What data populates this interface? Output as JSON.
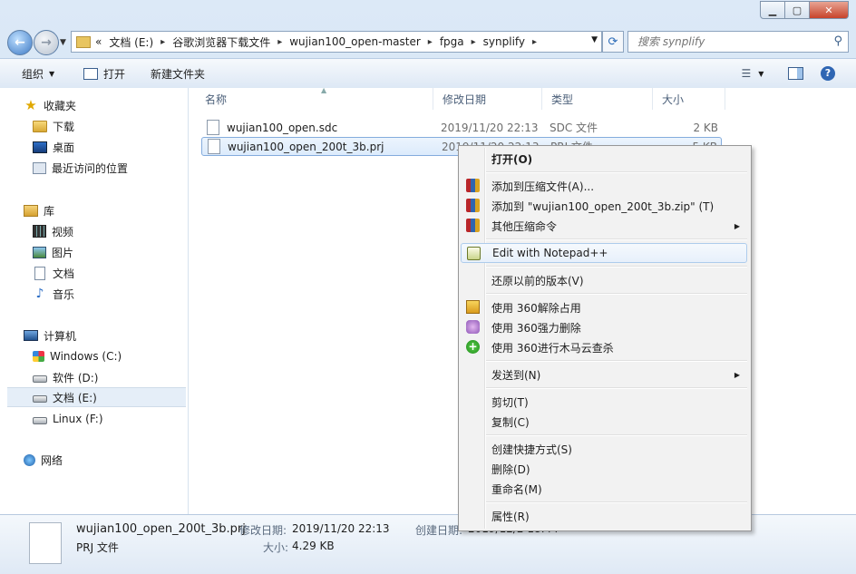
{
  "window": {
    "caption_buttons": [
      "minimize",
      "maximize",
      "close"
    ]
  },
  "address": {
    "overflow": "«",
    "segments": [
      "文档 (E:)",
      "谷歌浏览器下载文件",
      "wujian100_open-master",
      "fpga",
      "synplify"
    ]
  },
  "search": {
    "placeholder": "搜索 synplify"
  },
  "toolbar": {
    "organize": "组织",
    "open": "打开",
    "new_folder": "新建文件夹"
  },
  "sidebar": {
    "favorites": {
      "label": "收藏夹",
      "items": [
        "下载",
        "桌面",
        "最近访问的位置"
      ]
    },
    "libraries": {
      "label": "库",
      "items": [
        "视频",
        "图片",
        "文档",
        "音乐"
      ]
    },
    "computer": {
      "label": "计算机",
      "items": [
        "Windows (C:)",
        "软件 (D:)",
        "文档 (E:)",
        "Linux (F:)"
      ],
      "selected": "文档 (E:)"
    },
    "network": {
      "label": "网络"
    }
  },
  "columns": {
    "name": "名称",
    "modified": "修改日期",
    "type": "类型",
    "size": "大小"
  },
  "files": [
    {
      "name": "wujian100_open.sdc",
      "modified": "2019/11/20 22:13",
      "type": "SDC 文件",
      "size": "2 KB"
    },
    {
      "name": "wujian100_open_200t_3b.prj",
      "modified": "2019/11/20 22:13",
      "type": "PRJ 文件",
      "size": "5 KB",
      "selected": true
    }
  ],
  "context_menu": {
    "open": "打开(O)",
    "add_archive": "添加到压缩文件(A)...",
    "add_zip": "添加到 \"wujian100_open_200t_3b.zip\" (T)",
    "other_archive": "其他压缩命令",
    "notepad": "Edit with Notepad++",
    "restore": "还原以前的版本(V)",
    "unlock360": "使用 360解除占用",
    "delete360": "使用 360强力删除",
    "scan360": "使用 360进行木马云查杀",
    "send_to": "发送到(N)",
    "cut": "剪切(T)",
    "copy": "复制(C)",
    "shortcut": "创建快捷方式(S)",
    "delete": "删除(D)",
    "rename": "重命名(M)",
    "properties": "属性(R)"
  },
  "details": {
    "filename": "wujian100_open_200t_3b.prj",
    "filetype": "PRJ 文件",
    "modified_label": "修改日期:",
    "modified_value": "2019/11/20 22:13",
    "size_label": "大小:",
    "size_value": "4.29 KB",
    "created_label": "创建日期:",
    "created_value": "2019/12/2 18:44"
  }
}
